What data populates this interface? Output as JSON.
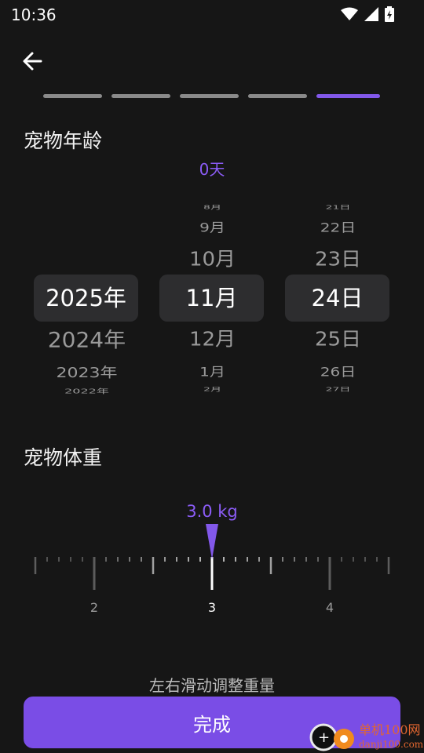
{
  "status_bar": {
    "time": "10:36"
  },
  "progress": {
    "total_steps": 5,
    "current_step": 5
  },
  "age": {
    "title": "宠物年龄",
    "value": "0天",
    "years": [
      "2025年",
      "2024年",
      "2023年",
      "2022年"
    ],
    "selected_year": "2025年",
    "months": [
      "8月",
      "9月",
      "10月",
      "11月",
      "12月",
      "1月",
      "2月"
    ],
    "selected_month": "11月",
    "days": [
      "21日",
      "22日",
      "23日",
      "24日",
      "25日",
      "26日",
      "27日"
    ],
    "selected_day": "24日"
  },
  "weight": {
    "title": "宠物体重",
    "value_label": "3.0 kg",
    "value": 3.0,
    "ticks": [
      "2",
      "3",
      "4"
    ],
    "hint": "左右滑动调整重量"
  },
  "actions": {
    "done_label": "完成"
  },
  "watermark": {
    "text": "单机100网",
    "url": "danji100.com"
  },
  "colors": {
    "accent": "#8258ea",
    "button": "#7a4de6",
    "background": "#161616"
  }
}
